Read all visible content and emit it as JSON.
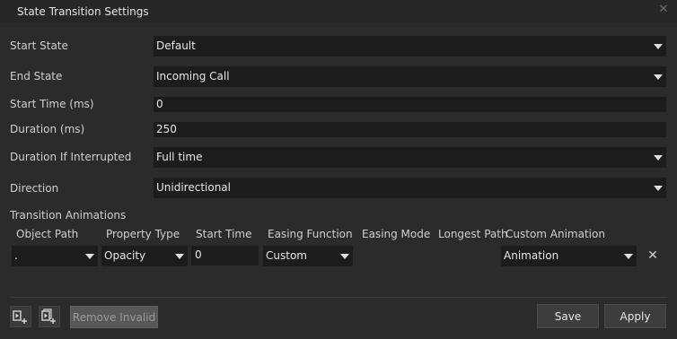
{
  "dialog": {
    "title": "State Transition Settings",
    "close_icon": "close-icon"
  },
  "fields": {
    "start_state": {
      "label": "Start State",
      "value": "Default"
    },
    "end_state": {
      "label": "End State",
      "value": "Incoming Call"
    },
    "start_time": {
      "label": "Start Time (ms)",
      "value": "0"
    },
    "duration": {
      "label": "Duration (ms)",
      "value": "250"
    },
    "duration_interrupted": {
      "label": "Duration If Interrupted",
      "value": "Full time"
    },
    "direction": {
      "label": "Direction",
      "value": "Unidirectional"
    }
  },
  "animations": {
    "section_label": "Transition Animations",
    "columns": [
      "Object Path",
      "Property Type",
      "Start Time",
      "Easing Function",
      "Easing Mode",
      "Longest Path",
      "Custom Animation"
    ],
    "rows": [
      {
        "object_path": ".",
        "property_type": "Opacity",
        "start_time": "0",
        "easing_function": "Custom",
        "custom_animation": "Animation"
      }
    ]
  },
  "footer": {
    "add_animation_icon": "add-animation-icon",
    "add_animations_icon": "add-multiple-animations-icon",
    "remove_invalid_label": "Remove Invalid",
    "save_label": "Save",
    "apply_label": "Apply"
  },
  "colors": {
    "background": "#2b2b2b",
    "field_background": "#1c1c1c",
    "text": "#d6d6d6"
  }
}
